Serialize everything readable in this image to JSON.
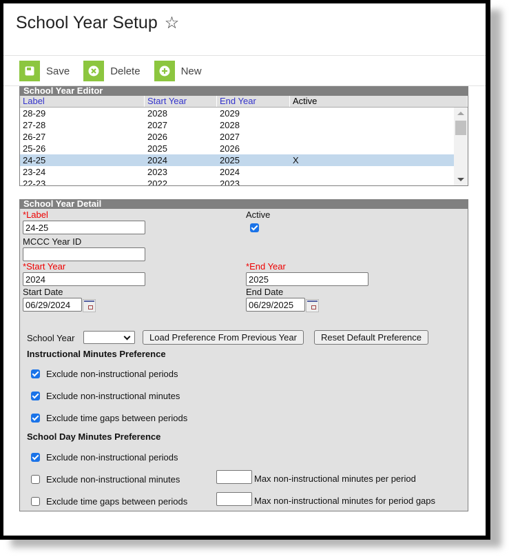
{
  "page": {
    "title": "School Year Setup",
    "favorite_icon": "star-outline-icon"
  },
  "toolbar": {
    "save_label": "Save",
    "delete_label": "Delete",
    "new_label": "New"
  },
  "editor": {
    "title": "School Year Editor",
    "columns": [
      "Label",
      "Start Year",
      "End Year",
      "Active"
    ],
    "rows": [
      {
        "label": "28-29",
        "start": "2028",
        "end": "2029",
        "active": ""
      },
      {
        "label": "27-28",
        "start": "2027",
        "end": "2028",
        "active": ""
      },
      {
        "label": "26-27",
        "start": "2026",
        "end": "2027",
        "active": ""
      },
      {
        "label": "25-26",
        "start": "2025",
        "end": "2026",
        "active": ""
      },
      {
        "label": "24-25",
        "start": "2024",
        "end": "2025",
        "active": "X",
        "selected": true
      },
      {
        "label": "23-24",
        "start": "2023",
        "end": "2024",
        "active": ""
      },
      {
        "label": "22-23",
        "start": "2022",
        "end": "2023",
        "active": ""
      }
    ]
  },
  "detail": {
    "title": "School Year Detail",
    "label_field": {
      "required_mark": "*",
      "label": "Label",
      "value": "24-25"
    },
    "active_field": {
      "label": "Active",
      "checked": true
    },
    "mccc_field": {
      "label": "MCCC Year ID",
      "value": ""
    },
    "start_year": {
      "required_mark": "*",
      "label": "Start Year",
      "value": "2024"
    },
    "end_year": {
      "required_mark": "*",
      "label": "End Year",
      "value": "2025"
    },
    "start_date": {
      "label": "Start Date",
      "value": "06/29/2024"
    },
    "end_date": {
      "label": "End Date",
      "value": "06/29/2025"
    },
    "school_year_select": {
      "label": "School Year",
      "value": ""
    },
    "load_pref_button": "Load Preference From Previous Year",
    "reset_pref_button": "Reset Default Preference",
    "instructional": {
      "heading": "Instructional Minutes Preference",
      "options": [
        {
          "label": "Exclude non-instructional periods",
          "checked": true
        },
        {
          "label": "Exclude non-instructional minutes",
          "checked": true
        },
        {
          "label": "Exclude time gaps between periods",
          "checked": true
        }
      ]
    },
    "school_day": {
      "heading": "School Day Minutes Preference",
      "options": [
        {
          "label": "Exclude non-instructional periods",
          "checked": true
        },
        {
          "label": "Exclude non-instructional minutes",
          "checked": false
        },
        {
          "label": "Exclude time gaps between periods",
          "checked": false
        }
      ],
      "max_per_period_label": "Max non-instructional minutes per period",
      "max_per_period_value": "",
      "max_gaps_label": "Max non-instructional minutes for period gaps",
      "max_gaps_value": ""
    }
  }
}
